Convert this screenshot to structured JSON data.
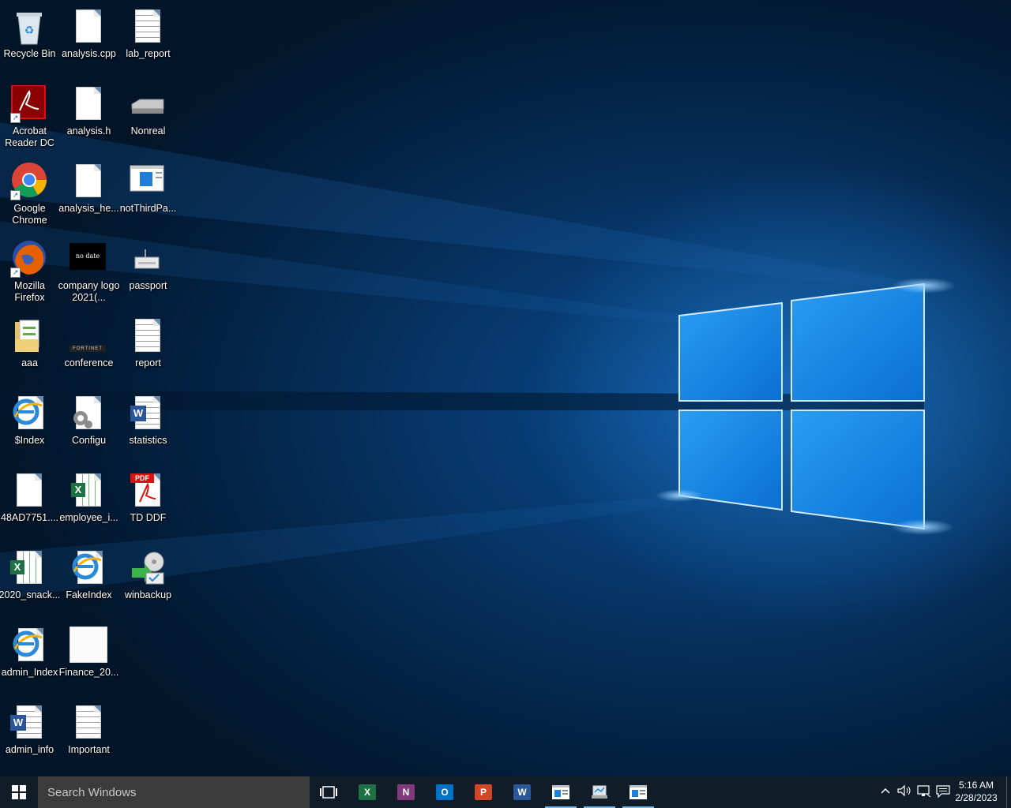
{
  "desktop": {
    "icons": [
      {
        "label": "Recycle Bin"
      },
      {
        "label": "analysis.cpp"
      },
      {
        "label": "lab_report"
      },
      {
        "label": "Acrobat Reader DC"
      },
      {
        "label": "analysis.h"
      },
      {
        "label": "Nonreal"
      },
      {
        "label": "Google Chrome"
      },
      {
        "label": "analysis_he..."
      },
      {
        "label": "notThirdPa..."
      },
      {
        "label": "Mozilla Firefox"
      },
      {
        "label": "company logo 2021(..."
      },
      {
        "label": "passport"
      },
      {
        "label": "aaa"
      },
      {
        "label": "conference"
      },
      {
        "label": "report"
      },
      {
        "label": "$Index"
      },
      {
        "label": "Configu"
      },
      {
        "label": "statistics"
      },
      {
        "label": "48AD7751...."
      },
      {
        "label": "employee_i..."
      },
      {
        "label": "TD DDF"
      },
      {
        "label": "2020_snack..."
      },
      {
        "label": "FakeIndex"
      },
      {
        "label": "winbackup"
      },
      {
        "label": "admin_Index"
      },
      {
        "label": "Finance_20..."
      },
      {
        "label": "admin_info"
      },
      {
        "label": "Important"
      }
    ],
    "thumbnail_text": {
      "company_logo": "no date",
      "conference": "FORTINET"
    },
    "pdf_badge": "PDF"
  },
  "taskbar": {
    "search_placeholder": "Search Windows",
    "apps": [
      {
        "name": "task-view-icon"
      },
      {
        "name": "excel-icon",
        "letter": "X",
        "color": "#1e7145"
      },
      {
        "name": "onenote-icon",
        "letter": "N",
        "color": "#80397b"
      },
      {
        "name": "outlook-icon",
        "letter": "O",
        "color": "#0072c6"
      },
      {
        "name": "powerpoint-icon",
        "letter": "P",
        "color": "#d24726"
      },
      {
        "name": "word-icon",
        "letter": "W",
        "color": "#2b579a"
      }
    ],
    "time": "5:16 AM",
    "date": "2/28/2023"
  },
  "colors": {
    "taskbar": "#101c28",
    "search": "#3b3b3b",
    "accent": "#76b9ed"
  }
}
